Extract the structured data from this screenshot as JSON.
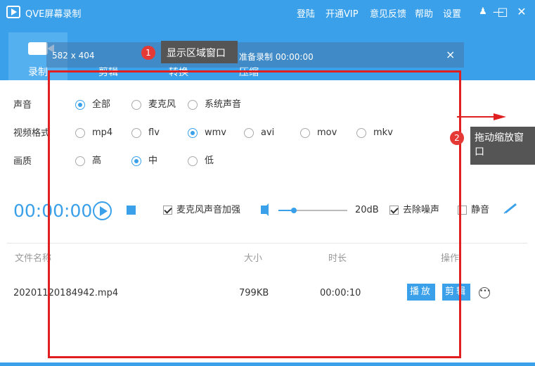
{
  "app": {
    "title": "QVE屏幕录制"
  },
  "top_menu": [
    "登陆",
    "开通VIP",
    "意见反馈",
    "帮助",
    "设置"
  ],
  "window_controls": {
    "shirt": "♟",
    "minimize": "—",
    "maximize": "□",
    "close": "✕"
  },
  "tabs": [
    {
      "label": "录制",
      "active": true
    },
    {
      "label": "剪辑",
      "active": false
    },
    {
      "label": "转换",
      "active": false
    },
    {
      "label": "压缩",
      "active": false
    }
  ],
  "overlay": {
    "size": "582 x 404",
    "status": "准备录制 00:00:00",
    "close": "×"
  },
  "callouts": [
    {
      "num": "1",
      "text": "显示区域窗口"
    },
    {
      "num": "2",
      "text": "拖动缩放窗口"
    }
  ],
  "settings": {
    "audio": {
      "label": "声音",
      "options": [
        "全部",
        "麦克风",
        "系统声音"
      ],
      "selected": 0
    },
    "format": {
      "label": "视频格式",
      "options": [
        "mp4",
        "flv",
        "wmv",
        "avi",
        "mov",
        "mkv"
      ],
      "selected": 2
    },
    "quality": {
      "label": "画质",
      "options": [
        "高",
        "中",
        "低"
      ],
      "selected": 1
    }
  },
  "controls": {
    "timer": "00:00:00",
    "mic_boost": {
      "label": "麦克风声音加强",
      "checked": true
    },
    "volume": {
      "value": 0.22,
      "db": "20dB"
    },
    "denoise": {
      "label": "去除噪声",
      "checked": true
    },
    "mute": {
      "label": "静音",
      "checked": false
    }
  },
  "table": {
    "headers": [
      "文件名称",
      "大小",
      "时长",
      "操作"
    ],
    "rows": [
      {
        "name": "20201120184942.mp4",
        "size": "799KB",
        "duration": "00:00:10",
        "actions": [
          "播放",
          "剪辑"
        ]
      }
    ]
  },
  "colors": {
    "accent": "#3aa0ea",
    "frame": "#e02020",
    "callout_num": "#e53935"
  }
}
